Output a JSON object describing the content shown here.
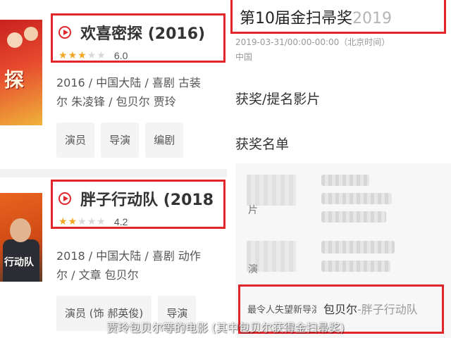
{
  "left": {
    "movies": [
      {
        "poster_text": "探",
        "title": "欢喜密探 (2016)",
        "rating": {
          "score": "6.0",
          "stars_filled": 3,
          "stars_total": 5
        },
        "info_line1": "2016 / 中国大陆 / 喜剧 古装",
        "info_line2": "尔 朱凌锋 / 包贝尔 贾玲",
        "chips": [
          "演员",
          "导演",
          "编剧"
        ]
      },
      {
        "poster_text": "行动队",
        "title": "胖子行动队 (2018",
        "rating": {
          "score": "4.2",
          "stars_filled": 2,
          "stars_total": 5
        },
        "info_line1": "2018 / 中国大陆 / 喜剧 动作",
        "info_line2": "尔 / 文章 包贝尔",
        "chips": [
          "演员 (饰 郝英俊)",
          "导演"
        ]
      }
    ]
  },
  "right": {
    "award_name": "第10届金扫帚奖",
    "award_year": "2019",
    "award_date": "2019-03-31/00:00-00:00（北京时间）",
    "award_place": "中国",
    "section_films": "获奖/提名影片",
    "section_list": "获奖名单",
    "list_rows": [
      {
        "category_tail": "片"
      },
      {
        "category_tail": "演"
      }
    ],
    "winner": {
      "category": "最令人失望新导演",
      "name": "包贝尔",
      "film": "-胖子行动队"
    }
  },
  "caption": "贾玲包贝尔等的电影 (其中包贝尔获得金扫帚奖)",
  "colors": {
    "highlight_red": "#e0262b",
    "star_on": "#f5a623",
    "star_off": "#d8d8d8"
  }
}
